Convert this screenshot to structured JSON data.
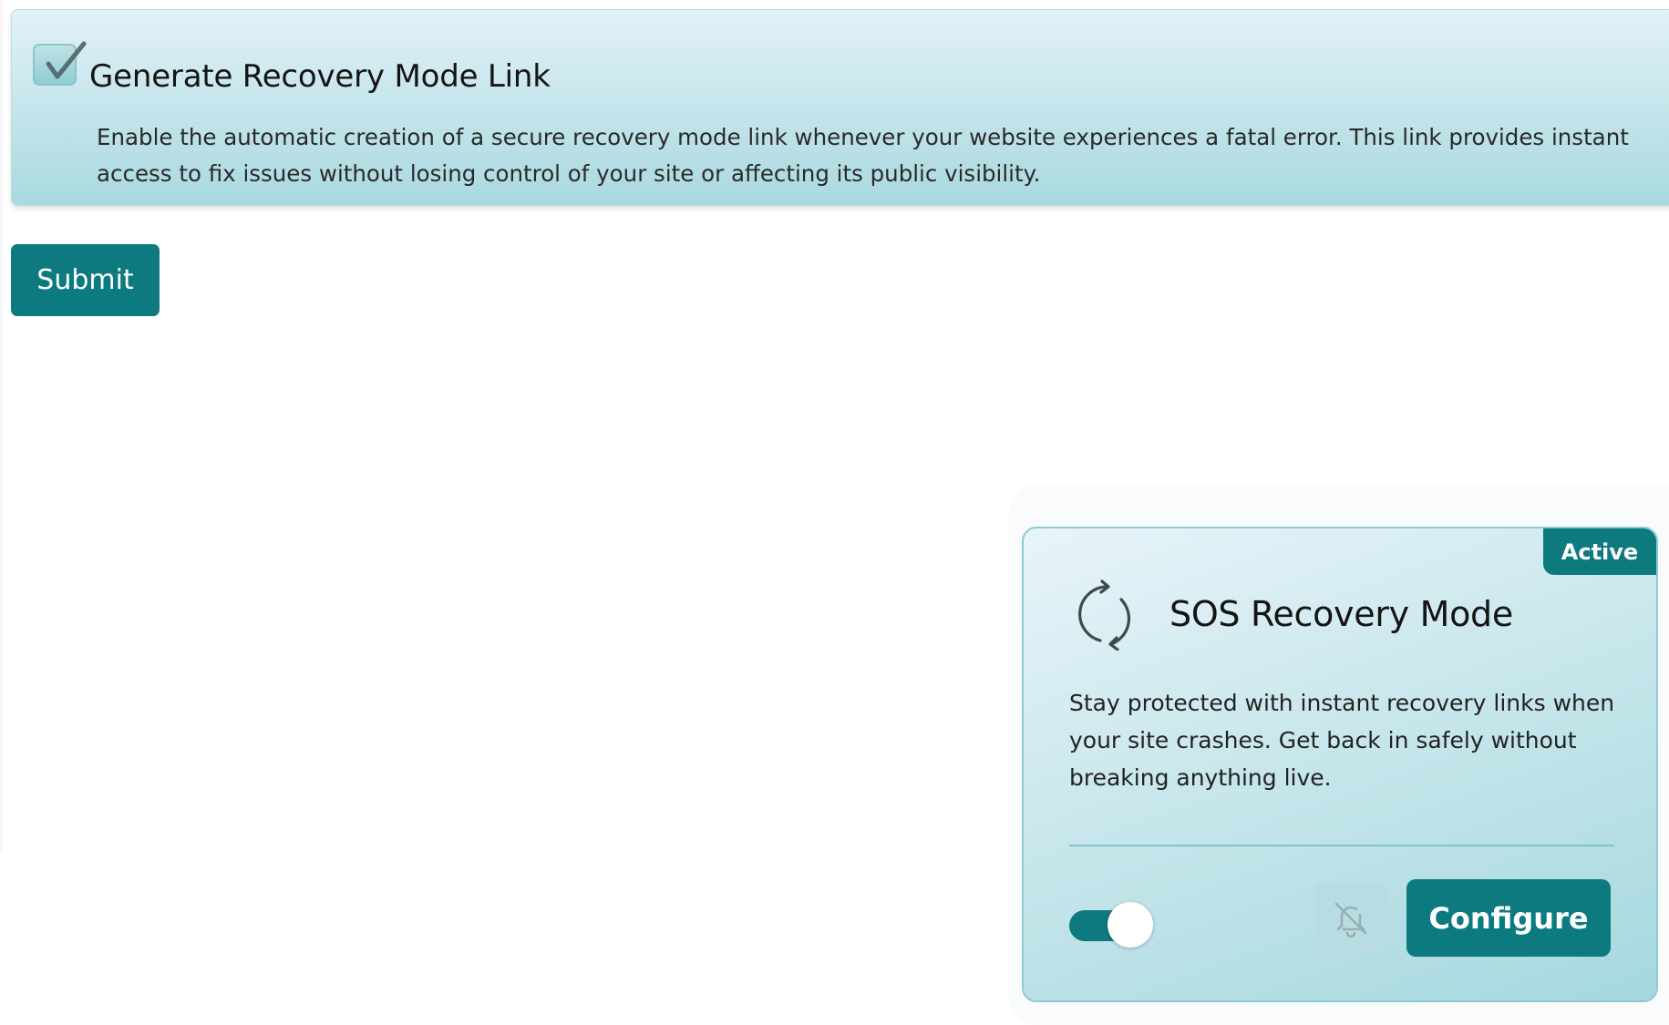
{
  "option": {
    "title": "Generate Recovery Mode Link",
    "description": "Enable the automatic creation of a secure recovery mode link whenever your website experiences a fatal error. This link provides instant access to fix issues without losing control of your site or affecting its public visibility.",
    "checked": true
  },
  "form": {
    "submit_label": "Submit"
  },
  "card": {
    "badge": "Active",
    "icon": "refresh-icon",
    "title": "SOS Recovery Mode",
    "description": "Stay protected with instant recovery links when your site crashes. Get back in safely without breaking anything live.",
    "toggle_on": true,
    "notification_icon": "bell-off-icon",
    "configure_label": "Configure"
  },
  "colors": {
    "accent": "#0d7a80",
    "panel_light": "#e2f1f8",
    "panel_dark": "#a9d9df"
  }
}
